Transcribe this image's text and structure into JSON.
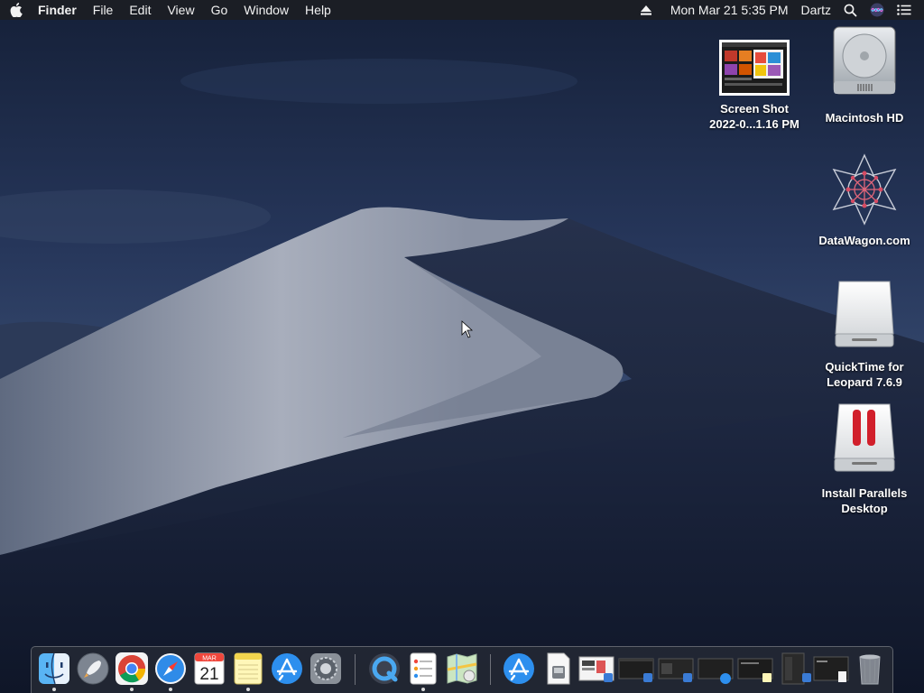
{
  "menubar": {
    "app_name": "Finder",
    "menus": [
      "File",
      "Edit",
      "View",
      "Go",
      "Window",
      "Help"
    ],
    "datetime": "Mon Mar 21  5:35 PM",
    "user": "Dartz"
  },
  "desktop": {
    "icons": [
      {
        "label_line1": "Screen Shot",
        "label_line2": "2022-0...1.16 PM",
        "icon": "screenshot-thumbnail-icon"
      },
      {
        "label_line1": "Macintosh HD",
        "label_line2": "",
        "icon": "hard-drive-icon"
      },
      {
        "label_line1": "DataWagon.com",
        "label_line2": "",
        "icon": "datawagon-logo-icon"
      },
      {
        "label_line1": "QuickTime for",
        "label_line2": "Leopard 7.6.9",
        "icon": "disk-image-icon"
      },
      {
        "label_line1": "Install Parallels",
        "label_line2": "Desktop",
        "icon": "parallels-installer-icon"
      }
    ]
  },
  "dock": {
    "calendar": {
      "month": "MAR",
      "day": "21"
    },
    "apps": [
      "Finder",
      "Launchpad",
      "Google Chrome",
      "Safari",
      "Calendar",
      "Notes",
      "App Store",
      "System Preferences",
      "QuickTime Player",
      "Reminders",
      "Maps",
      "App Store",
      "Document",
      "Screenshot",
      "Window",
      "Window",
      "Window",
      "Window",
      "Window",
      "Window",
      "Trash"
    ]
  },
  "colors": {
    "menubar_bg": "#1c1e24",
    "sky_top": "#17223a",
    "sky_bottom": "#3a4a68",
    "dune_light": "#aab0bd"
  }
}
